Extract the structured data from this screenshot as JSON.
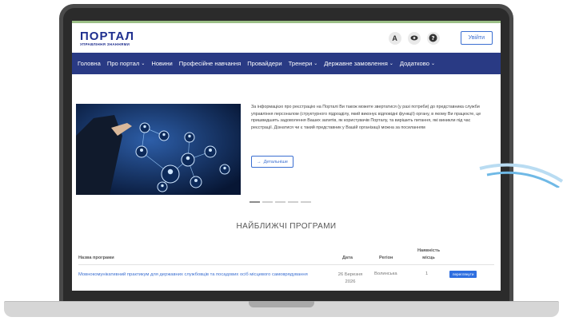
{
  "header": {
    "logo_main": "ПОРТАЛ",
    "logo_sub": "УПРАВЛІННЯ ЗНАННЯМИ",
    "font_tool": "A",
    "login_label": "Увійти"
  },
  "nav": {
    "items": [
      {
        "label": "Головна"
      },
      {
        "label": "Про портал",
        "caret": "⌄"
      },
      {
        "label": "Новини"
      },
      {
        "label": "Професійне навчання"
      },
      {
        "label": "Провайдери"
      },
      {
        "label": "Тренери",
        "caret": "⌄"
      },
      {
        "label": "Державне замовлення",
        "caret": "⌄"
      },
      {
        "label": "Додатково",
        "caret": "⌄"
      }
    ]
  },
  "slider": {
    "text": "За інформацією про реєстрацію на Порталі Ви також можете звертатися (у разі потреби) до представника служби управління персоналом (структурного підрозділу, який виконує відповідні функції) органу, в якому Ви працюєте, це пришвидшить задоволення Ваших запитів, як користувачів Порталу, та вирішить питання, які виникли під час реєстрації. Дізнатися чи є такий представник у Вашій організації можна за посиланням",
    "button_label": "Детальніше",
    "button_icon": "→"
  },
  "section": {
    "title": "НАЙБЛИЖЧІ ПРОГРАМИ"
  },
  "table": {
    "headers": {
      "name": "Назва програми",
      "date": "Дата",
      "region": "Регіон",
      "availability": "Наявність місць"
    },
    "rows": [
      {
        "name": "Мовнокомунікативний практикум для державних службовців та посадових осіб місцевого самоврядування",
        "date": "26 Березня 2026",
        "region": "Волинська",
        "availability": "1",
        "action": "переглянути"
      }
    ]
  },
  "colors": {
    "nav_bg": "#293a84",
    "accent": "#3b6fd1",
    "action_button": "#2f6fe0"
  }
}
